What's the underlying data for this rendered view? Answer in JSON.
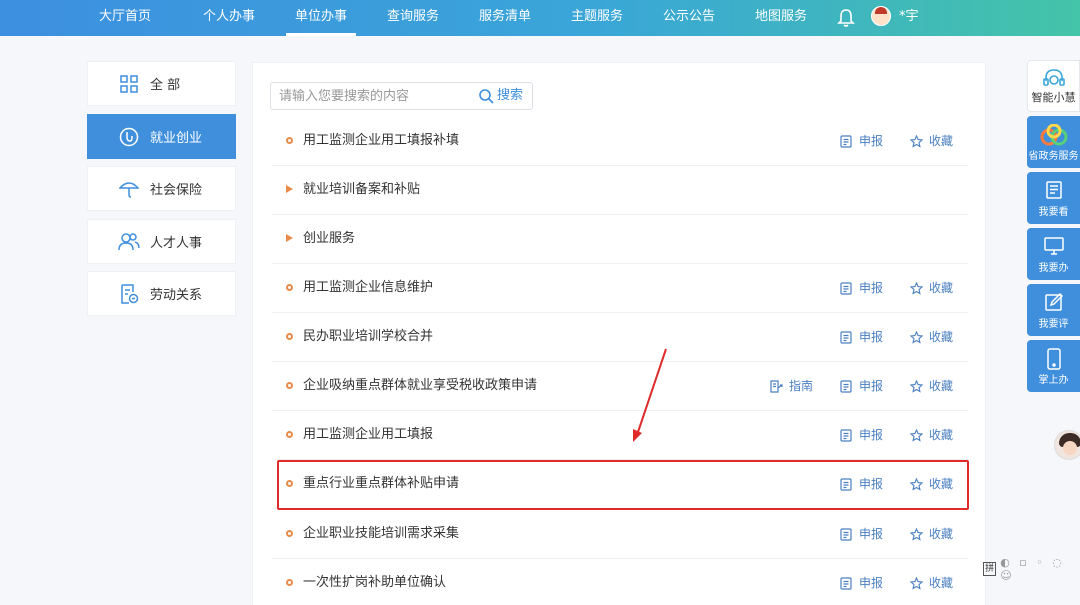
{
  "nav": {
    "items": [
      {
        "label": "大厅首页"
      },
      {
        "label": "个人办事"
      },
      {
        "label": "单位办事"
      },
      {
        "label": "查询服务"
      },
      {
        "label": "服务清单"
      },
      {
        "label": "主题服务"
      },
      {
        "label": "公示公告"
      },
      {
        "label": "地图服务"
      }
    ],
    "active": "单位办事",
    "user_name": "*宇"
  },
  "categories": [
    {
      "label": "全 部",
      "icon": "grid-icon"
    },
    {
      "label": "就业创业",
      "icon": "employment-icon"
    },
    {
      "label": "社会保险",
      "icon": "umbrella-icon"
    },
    {
      "label": "人才人事",
      "icon": "people-icon"
    },
    {
      "label": "劳动关系",
      "icon": "document-icon"
    }
  ],
  "active_category": "就业创业",
  "search": {
    "placeholder": "请输入您要搜索的内容",
    "value": "",
    "button": "搜索"
  },
  "actions": {
    "apply": "申报",
    "favorite": "收藏",
    "guide": "指南"
  },
  "services": [
    {
      "title": "用工监测企业用工填报补填"
    },
    {
      "title": "就业培训备案和补贴"
    },
    {
      "title": "创业服务"
    },
    {
      "title": "用工监测企业信息维护"
    },
    {
      "title": "民办职业培训学校合并"
    },
    {
      "title": "企业吸纳重点群体就业享受税收政策申请"
    },
    {
      "title": "用工监测企业用工填报"
    },
    {
      "title": "重点行业重点群体补贴申请"
    },
    {
      "title": "企业职业技能培训需求采集"
    },
    {
      "title": "一次性扩岗补助单位确认"
    }
  ],
  "highlighted_service": "重点行业重点群体补贴申请",
  "side_toolbar": {
    "assistant": "智能小慧",
    "buttons": [
      {
        "label": "省政务服务",
        "icon": "gov-logo-icon"
      },
      {
        "label": "我要看",
        "icon": "book-icon"
      },
      {
        "label": "我要办",
        "icon": "monitor-icon"
      },
      {
        "label": "我要评",
        "icon": "edit-icon"
      },
      {
        "label": "掌上办",
        "icon": "phone-icon"
      }
    ]
  },
  "ime": {
    "label": "拼"
  },
  "colors": {
    "primary": "#3f8fdc",
    "accent": "#e88a4a",
    "highlight": "#e02b2b"
  }
}
